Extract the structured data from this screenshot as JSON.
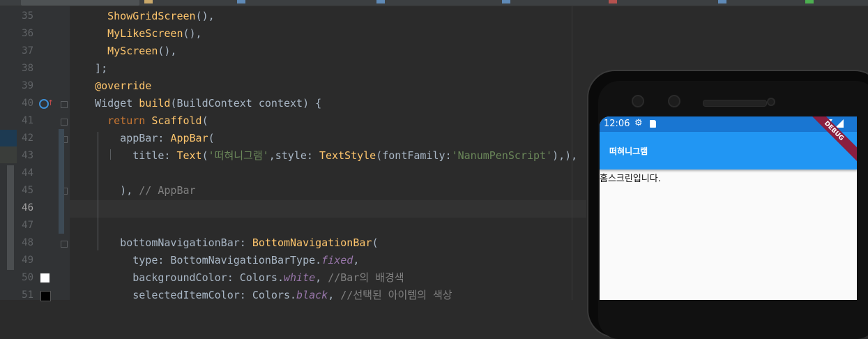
{
  "lines": [
    {
      "no": "35",
      "tokens": [
        {
          "t": "    "
        },
        {
          "t": "ShowGridScreen",
          "c": "fn"
        },
        {
          "t": "(),"
        }
      ]
    },
    {
      "no": "36",
      "tokens": [
        {
          "t": "    "
        },
        {
          "t": "MyLikeScreen",
          "c": "fn"
        },
        {
          "t": "(),"
        }
      ]
    },
    {
      "no": "37",
      "tokens": [
        {
          "t": "    "
        },
        {
          "t": "MyScreen",
          "c": "fn"
        },
        {
          "t": "(),"
        }
      ]
    },
    {
      "no": "38",
      "tokens": [
        {
          "t": "  ];"
        }
      ]
    },
    {
      "no": "39",
      "tokens": [
        {
          "t": "  "
        },
        {
          "t": "@override",
          "c": "fn"
        }
      ]
    },
    {
      "no": "40",
      "tokens": [
        {
          "t": "  Widget "
        },
        {
          "t": "build",
          "c": "fn"
        },
        {
          "t": "(BuildContext context) {"
        }
      ]
    },
    {
      "no": "41",
      "tokens": [
        {
          "t": "    "
        },
        {
          "t": "return",
          "c": "kw"
        },
        {
          "t": " "
        },
        {
          "t": "Scaffold",
          "c": "fn"
        },
        {
          "t": "("
        }
      ]
    },
    {
      "no": "42",
      "tokens": [
        {
          "t": "      appBar: "
        },
        {
          "t": "AppBar",
          "c": "fn"
        },
        {
          "t": "("
        }
      ]
    },
    {
      "no": "43",
      "tokens": [
        {
          "t": "        title: "
        },
        {
          "t": "Text",
          "c": "fn"
        },
        {
          "t": "("
        },
        {
          "t": "'떠혀니그램'",
          "c": "str"
        },
        {
          "t": ",style: "
        },
        {
          "t": "TextStyle",
          "c": "fn"
        },
        {
          "t": "(fontFamily:"
        },
        {
          "t": "'NanumPenScript'",
          "c": "str"
        },
        {
          "t": "),),"
        }
      ]
    },
    {
      "no": "44",
      "tokens": [
        {
          "t": ""
        }
      ]
    },
    {
      "no": "45",
      "tokens": [
        {
          "t": "      ), "
        },
        {
          "t": "// AppBar",
          "c": "cm"
        }
      ]
    },
    {
      "no": "46",
      "tokens": [
        {
          "t": ""
        }
      ]
    },
    {
      "no": "47",
      "tokens": [
        {
          "t": ""
        }
      ]
    },
    {
      "no": "48",
      "tokens": [
        {
          "t": "      bottomNavigationBar: "
        },
        {
          "t": "BottomNavigationBar",
          "c": "fn"
        },
        {
          "t": "("
        }
      ]
    },
    {
      "no": "49",
      "tokens": [
        {
          "t": "        type: BottomNavigationBarType."
        },
        {
          "t": "fixed",
          "c": "field"
        },
        {
          "t": ","
        }
      ]
    },
    {
      "no": "50",
      "tokens": [
        {
          "t": "        backgroundColor: Colors."
        },
        {
          "t": "white",
          "c": "field"
        },
        {
          "t": ", "
        },
        {
          "t": "//Bar의 배경색",
          "c": "cm"
        }
      ]
    },
    {
      "no": "51",
      "tokens": [
        {
          "t": "        selectedItemColor: Colors."
        },
        {
          "t": "black",
          "c": "field"
        },
        {
          "t": ", "
        },
        {
          "t": "//선택된 아이템의 색상",
          "c": "cm"
        }
      ]
    }
  ],
  "current_line": "46",
  "swatches": {
    "line50": "#ffffff",
    "line51": "#000000"
  },
  "phone": {
    "status_time": "12:06",
    "appbar_title": "떠혀니그램",
    "body_text": "홈스크린입니다.",
    "debug_banner": "DEBUG"
  },
  "colors": {
    "appbar": "#2196f3",
    "statusbar": "#1976d2",
    "debug": "#8b1e3f"
  }
}
